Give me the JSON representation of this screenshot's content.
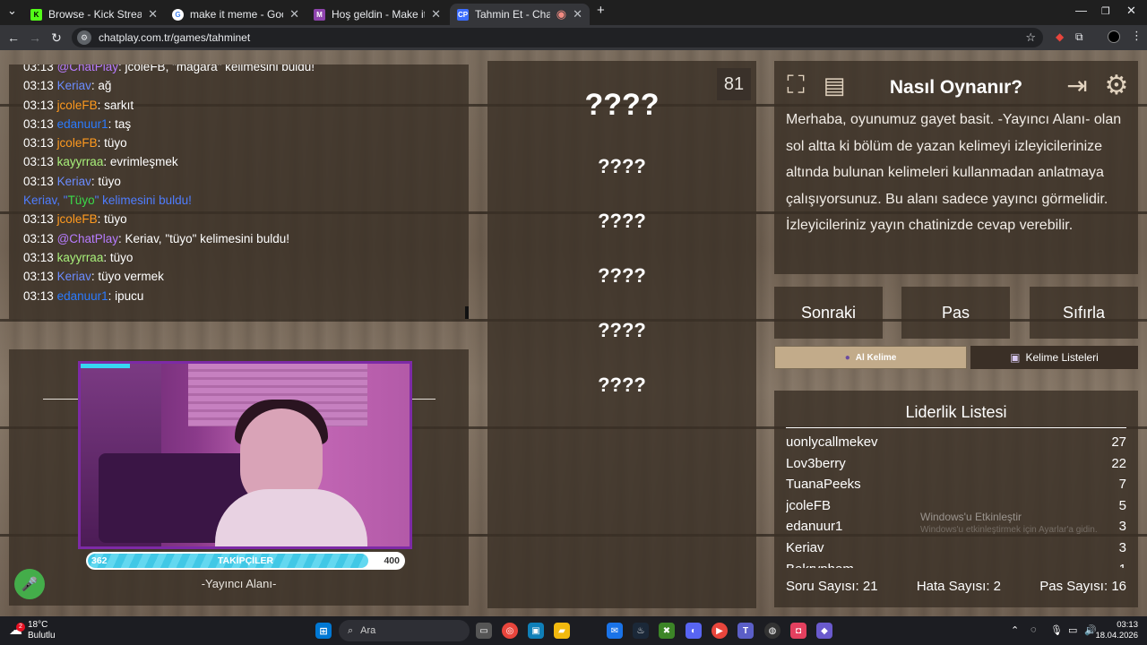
{
  "browser": {
    "tabs": [
      {
        "title": "Browse - Kick Streaming",
        "favicon": "kick-icon",
        "color": "#53fc18",
        "active": false
      },
      {
        "title": "make it meme - Google'da Ara",
        "favicon": "google-icon",
        "color": "#ffffff",
        "active": false
      },
      {
        "title": "Hoş geldin - Make it Meme",
        "favicon": "mim-icon",
        "color": "#8e44ad",
        "active": false
      },
      {
        "title": "Tahmin Et - ChatPlay",
        "favicon": "chatplay-icon",
        "color": "#3b6cff",
        "active": true
      }
    ],
    "url": "chatplay.com.tr/games/tahminet"
  },
  "chat": {
    "messages": [
      {
        "time": "03:13",
        "user": "@ChatPlay",
        "user_color": "#b77cff",
        "text": ": jcoleFB, \"mağara\" kelimesini buldu!"
      },
      {
        "time": "03:13",
        "user": "Keriav",
        "user_color": "#6b8cff",
        "text": ": ağ"
      },
      {
        "time": "03:13",
        "user": "jcoleFB",
        "user_color": "#ff9a1f",
        "text": ": sarkıt"
      },
      {
        "time": "03:13",
        "user": "edanuur1",
        "user_color": "#2b7bff",
        "text": ": taş"
      },
      {
        "time": "03:13",
        "user": "jcoleFB",
        "user_color": "#ff9a1f",
        "text": ": tüyo"
      },
      {
        "time": "03:13",
        "user": "kayyrraa",
        "user_color": "#a8f07a",
        "text": ": evrimleşmek"
      },
      {
        "time": "03:13",
        "user": "Keriav",
        "user_color": "#6b8cff",
        "text": ": tüyo"
      },
      {
        "system": true,
        "pre": "Keriav, \"",
        "word": "Tüyo",
        "post": "\" kelimesini buldu!"
      },
      {
        "time": "03:13",
        "user": "jcoleFB",
        "user_color": "#ff9a1f",
        "text": ": tüyo"
      },
      {
        "time": "03:13",
        "user": "@ChatPlay",
        "user_color": "#b77cff",
        "text": ": Keriav, \"tüyo\" kelimesini buldu!"
      },
      {
        "time": "03:13",
        "user": "kayyrraa",
        "user_color": "#a8f07a",
        "text": ": tüyo"
      },
      {
        "time": "03:13",
        "user": "Keriav",
        "user_color": "#6b8cff",
        "text": ": tüyo vermek"
      },
      {
        "time": "03:13",
        "user": "edanuur1",
        "user_color": "#2b7bff",
        "text": ": ipucu"
      }
    ]
  },
  "streamer": {
    "follow_min": "362",
    "follow_label": "TAKİPÇİLER",
    "follow_max": "400",
    "follow_progress": 0.89,
    "area_label": "-Yayıncı Alanı-"
  },
  "game": {
    "timer": "81",
    "main_word": "????",
    "forbidden_words": [
      "????",
      "????",
      "????",
      "????",
      "????"
    ]
  },
  "howto": {
    "title": "Nasıl Oynanır?",
    "text": "Merhaba, oyunumuz gayet basit. -Yayıncı Alanı- olan sol altta ki bölüm de yazan kelimeyi izleyicilerinize altında bulunan kelimeleri kullanmadan anlatmaya çalışıyorsunuz. Bu alanı sadece yayıncı görmelidir. İzleyicileriniz yayın chatinizde cevap verebilir."
  },
  "actions": {
    "next": "Sonraki",
    "pass": "Pas",
    "reset": "Sıfırla",
    "get_word": "Al Kelime",
    "word_lists": "Kelime Listeleri"
  },
  "leaderboard": {
    "title": "Liderlik Listesi",
    "rows": [
      {
        "name": "uonlycallmekev",
        "score": "27"
      },
      {
        "name": "Lov3berry",
        "score": "22"
      },
      {
        "name": "TuanaPeeks",
        "score": "7"
      },
      {
        "name": "jcoleFB",
        "score": "5"
      },
      {
        "name": "edanuur1",
        "score": "3"
      },
      {
        "name": "Keriav",
        "score": "3"
      },
      {
        "name": "Bekrvphem",
        "score": "1"
      }
    ],
    "question_count": "Soru Sayısı: 21",
    "error_count": "Hata Sayısı: 2",
    "pass_count": "Pas Sayısı: 16"
  },
  "watermark": {
    "line1": "Windows'u Etkinleştir",
    "line2": "Windows'u etkinleştirmek için Ayarlar'a gidin."
  },
  "taskbar": {
    "temperature": "18°C",
    "weather": "Bulutlu",
    "weather_badge": "2",
    "search_placeholder": "Ara",
    "time": "03:13",
    "date": "18.04.2026"
  },
  "colors": {
    "accent_follow": "#41c8e6",
    "mic_green": "#44ad4a",
    "cam_border": "#7d2aa6",
    "system_word_green": "#3bd94a",
    "system_text_blue": "#4f7dff"
  }
}
